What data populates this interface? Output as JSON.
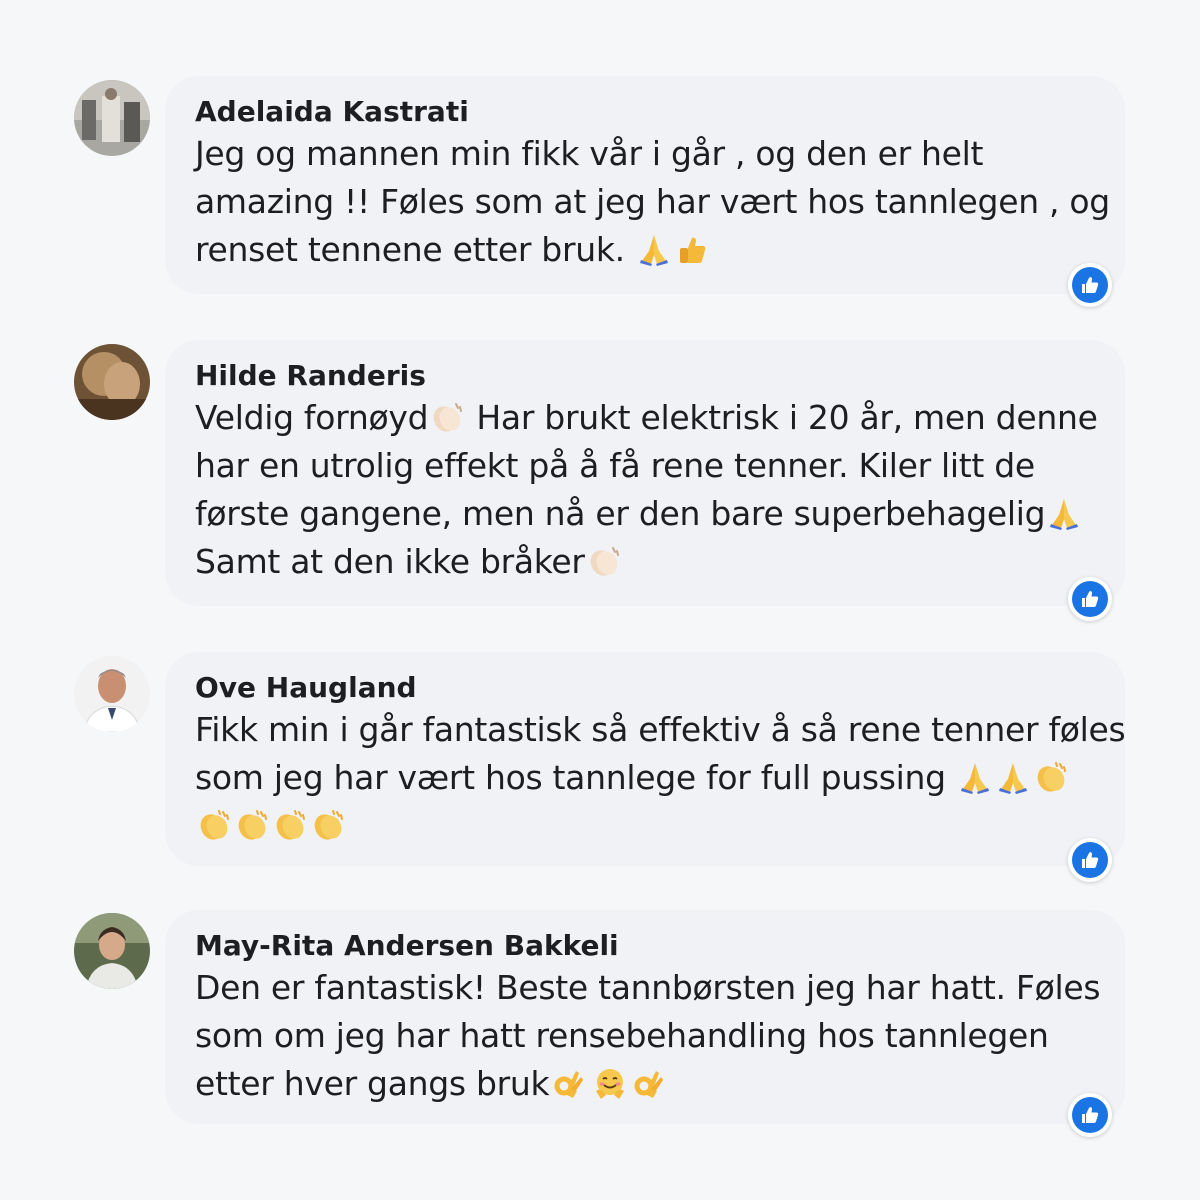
{
  "comments": [
    {
      "name": "Adelaida Kastrati",
      "text_lines": [
        "Jeg og mannen min fikk vår i går , og den er helt",
        "amazing !! Føles som at jeg har vært hos tannlegen , og",
        "renset tennene etter bruk. "
      ],
      "emojis": [
        "praying-hands",
        "thumbs-up"
      ],
      "reaction": "like"
    },
    {
      "name": "Hilde Randeris",
      "text_lines": [
        "Veldig fornøyd",
        " Har brukt elektrisk i 20 år, men denne",
        "har en utrolig effekt på å få rene tenner. Kiler litt de",
        "første gangene, men nå er den bare superbehagelig",
        "Samt at den ikke bråker"
      ],
      "emojis": [
        "clapping-hands",
        "praying-hands",
        "clapping-hands"
      ],
      "reaction": "like"
    },
    {
      "name": "Ove Haugland",
      "text_lines": [
        "Fikk min i går fantastisk så effektiv å så rene tenner føles",
        "som jeg har vært hos tannlege for full pussing "
      ],
      "emojis": [
        "praying-hands",
        "praying-hands",
        "clapping-hands",
        "clapping-hands",
        "clapping-hands",
        "clapping-hands",
        "clapping-hands"
      ],
      "reaction": "like"
    },
    {
      "name": "May-Rita Andersen Bakkeli",
      "text_lines": [
        "Den er fantastisk! Beste tannbørsten jeg har hatt. Føles",
        "som om jeg har hatt rensebehandling hos tannlegen",
        "etter hver gangs bruk"
      ],
      "emojis": [
        "ok-hand",
        "smiling-face-with-open-hands",
        "ok-hand"
      ],
      "reaction": "like"
    }
  ],
  "colors": {
    "background": "#f6f7f9",
    "bubble": "#f0f2f5",
    "like_blue": "#1b74e4",
    "text": "#1c1e21"
  }
}
